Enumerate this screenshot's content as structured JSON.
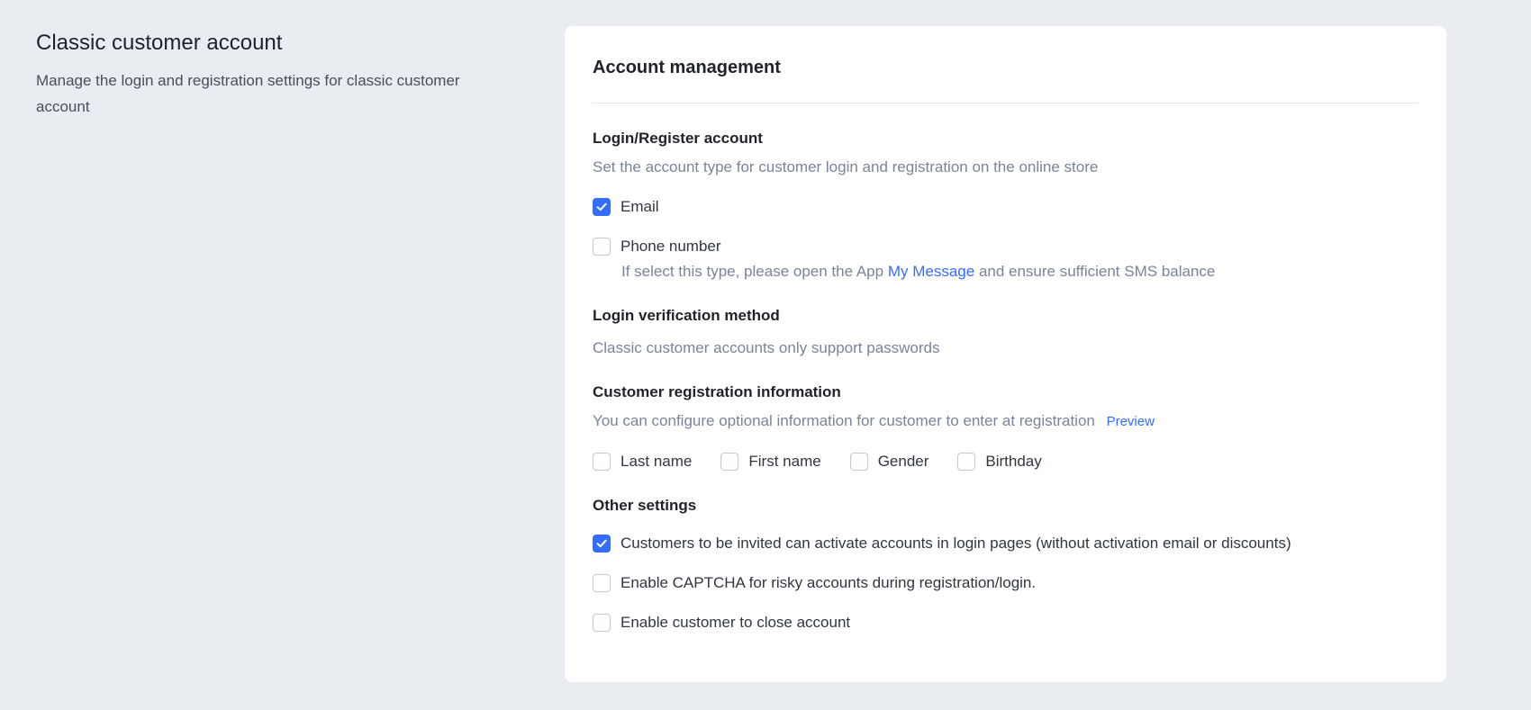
{
  "intro": {
    "title": "Classic customer account",
    "description": "Manage the login and registration settings for classic customer account"
  },
  "card": {
    "title": "Account management",
    "login_register": {
      "title": "Login/Register account",
      "description": "Set the account type for customer login and registration on the online store",
      "options": [
        {
          "label": "Email",
          "checked": true
        },
        {
          "label": "Phone number",
          "checked": false
        }
      ],
      "phone_note_before": "If select this type, please open the App",
      "phone_note_link": "My Message",
      "phone_note_after": "and ensure sufficient SMS balance"
    },
    "verification": {
      "title": "Login verification method",
      "description": "Classic customer accounts only support passwords"
    },
    "registration_info": {
      "title": "Customer registration information",
      "description": "You can configure optional information for customer to enter at registration",
      "preview_link": "Preview",
      "fields": [
        {
          "label": "Last name",
          "checked": false
        },
        {
          "label": "First name",
          "checked": false
        },
        {
          "label": "Gender",
          "checked": false
        },
        {
          "label": "Birthday",
          "checked": false
        }
      ]
    },
    "other": {
      "title": "Other settings",
      "options": [
        {
          "label": "Customers to be invited can activate accounts in login pages (without activation email or discounts)",
          "checked": true
        },
        {
          "label": "Enable CAPTCHA for risky accounts during registration/login.",
          "checked": false
        },
        {
          "label": "Enable customer to close account",
          "checked": false
        }
      ]
    }
  },
  "colors": {
    "accent": "#356dff",
    "background": "#e9ecf1",
    "card": "#ffffff"
  }
}
